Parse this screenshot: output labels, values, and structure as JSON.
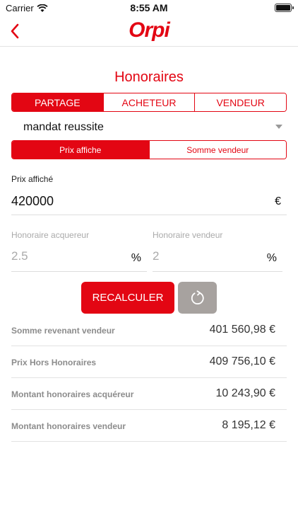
{
  "status": {
    "carrier": "Carrier",
    "time": "8:55 AM"
  },
  "nav": {
    "logo": "Orpi"
  },
  "page": {
    "title": "Honoraires"
  },
  "tabs": [
    {
      "label": "PARTAGE",
      "active": true
    },
    {
      "label": "ACHETEUR",
      "active": false
    },
    {
      "label": "VENDEUR",
      "active": false
    }
  ],
  "mandate": {
    "selected": "mandat reussite"
  },
  "subtabs": [
    {
      "label": "Prix affiche",
      "active": true
    },
    {
      "label": "Somme vendeur",
      "active": false
    }
  ],
  "price": {
    "label": "Prix affiché",
    "value": "420000",
    "unit": "€"
  },
  "fees": {
    "buyer": {
      "label": "Honoraire acquereur",
      "value": "2.5",
      "unit": "%"
    },
    "seller": {
      "label": "Honoraire vendeur",
      "value": "2",
      "unit": "%"
    }
  },
  "actions": {
    "recalc_label": "RECALCULER"
  },
  "results": [
    {
      "label": "Somme revenant vendeur",
      "value": "401 560,98 €"
    },
    {
      "label": "Prix Hors Honoraires",
      "value": "409 756,10 €"
    },
    {
      "label": "Montant honoraires acquéreur",
      "value": "10 243,90 €"
    },
    {
      "label": "Montant honoraires vendeur",
      "value": "8 195,12 €"
    }
  ],
  "colors": {
    "accent": "#e30613",
    "reset_button": "#a7a29f",
    "muted_text": "#8c8c8c"
  }
}
